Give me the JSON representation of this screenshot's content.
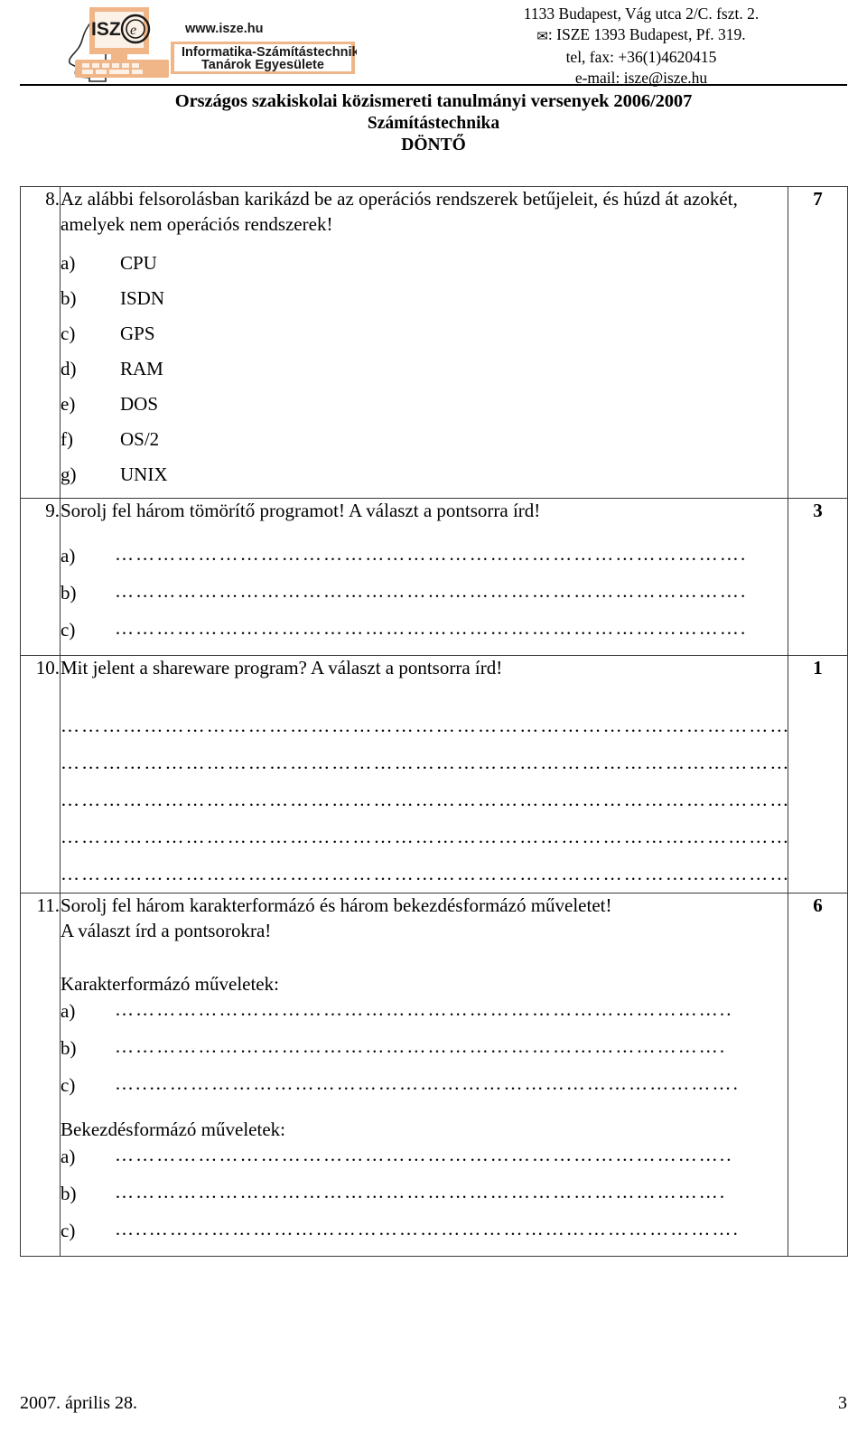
{
  "header": {
    "logo": {
      "name": "isze-logo",
      "acronym": "ISZ",
      "emblem_letter": "e",
      "website": "www.isze.hu",
      "org_line1": "Informatika-Számítástechnika",
      "org_line2": "Tanárok Egyesülete",
      "accent_color": "#F0B687",
      "accent_light": "#FAE0CB"
    },
    "address": [
      "1133 Budapest, Vág utca 2/C. fszt. 2.",
      ": ISZE 1393 Budapest, Pf. 319.",
      "tel, fax: +36(1)4620415",
      "e-mail: isze@isze.hu"
    ],
    "envelope_glyph": "✉"
  },
  "title": {
    "line1": "Országos szakiskolai közismereti tanulmányi versenyek 2006/2007",
    "line2": "Számítástechnika",
    "line3": "DÖNTŐ"
  },
  "questions": [
    {
      "number": "8.",
      "points": "7",
      "text": "Az alábbi felsorolásban karikázd be az operációs rendszerek betűjeleit, és húzd át azokét, amelyek nem operációs rendszerek!",
      "options": [
        {
          "key": "a)",
          "value": "CPU"
        },
        {
          "key": "b)",
          "value": "ISDN"
        },
        {
          "key": "c)",
          "value": "GPS"
        },
        {
          "key": "d)",
          "value": "RAM"
        },
        {
          "key": "e)",
          "value": "DOS"
        },
        {
          "key": "f)",
          "value": "OS/2"
        },
        {
          "key": "g)",
          "value": "UNIX"
        }
      ]
    },
    {
      "number": "9.",
      "points": "3",
      "text": "Sorolj fel három tömörítő programot! A választ a pontsorra írd!",
      "answers": [
        {
          "key": "a)",
          "dots": "………………………………………………………………………………."
        },
        {
          "key": "b)",
          "dots": "………………………………………………………………………………."
        },
        {
          "key": "c)",
          "dots": "………………………………………………………………………………."
        }
      ]
    },
    {
      "number": "10.",
      "points": "1",
      "text": "Mit jelent a shareware program? A választ a pontsorra írd!",
      "lines": [
        "…………………………………………………………………………………………….",
        "…………………………………………………………………………………………….",
        "…………………………………………………………………………………………….",
        "…………………………………………………………………………………………….",
        "……………………………………………………………………………………………."
      ]
    },
    {
      "number": "11.",
      "points": "6",
      "text_line1": "Sorolj fel három karakterformázó és három bekezdésformázó műveletet!",
      "text_line2": "A választ írd a pontsorokra!",
      "group1_label": "Karakterformázó műveletek:",
      "group1": [
        {
          "key": "a)",
          "dots": "…………………………………………………………………………….."
        },
        {
          "key": "b)",
          "dots": "……………………………………………………………………………."
        },
        {
          "key": "c)",
          "dots": "…..…………………………………………………………………………."
        }
      ],
      "group2_label": "Bekezdésformázó műveletek:",
      "group2": [
        {
          "key": "a)",
          "dots": "…………………………………………………………………………….."
        },
        {
          "key": "b)",
          "dots": "……………………………………………………………………………."
        },
        {
          "key": "c)",
          "dots": "…..…………………………………………………………………………."
        }
      ]
    }
  ],
  "footer": {
    "date": "2007. április 28.",
    "page_number": "3"
  }
}
